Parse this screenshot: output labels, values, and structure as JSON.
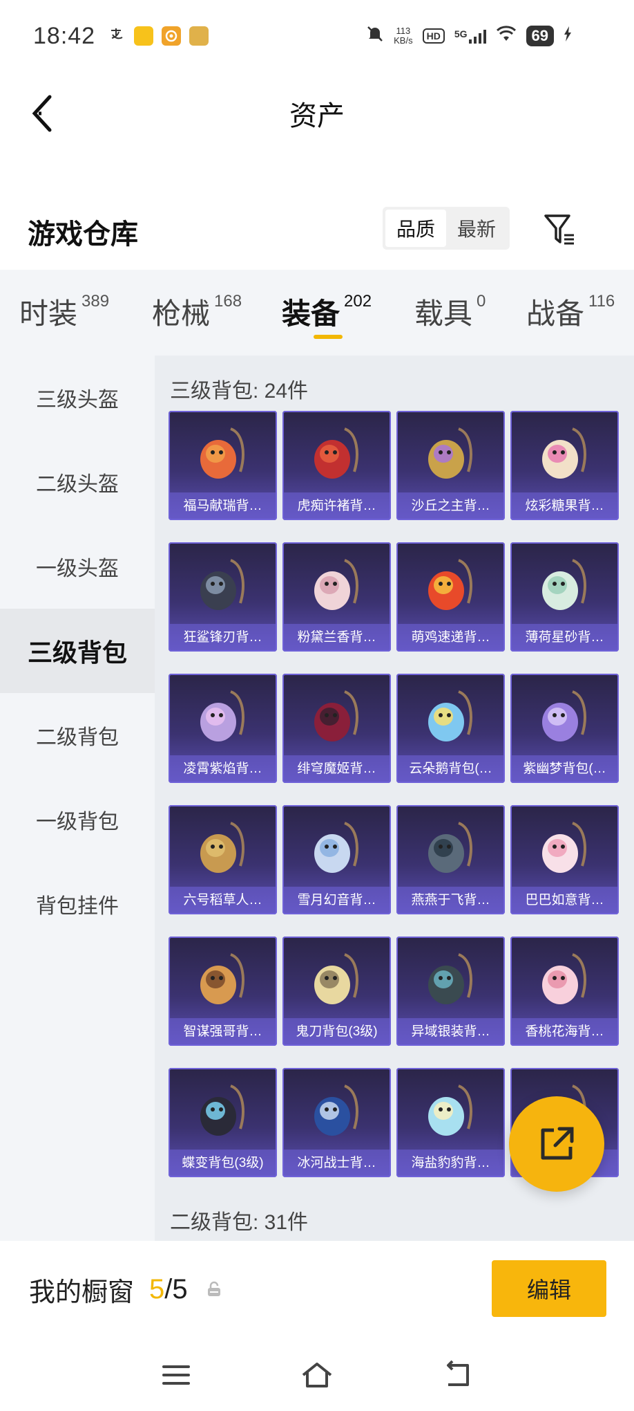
{
  "status_bar": {
    "time": "18:42",
    "net_speed_value": "113",
    "net_speed_unit": "KB/s",
    "hd_label": "HD",
    "network": "5G",
    "battery": "69"
  },
  "header": {
    "title": "资产"
  },
  "section": {
    "title": "游戏仓库",
    "sort_options": [
      "品质",
      "最新"
    ],
    "active_sort": "品质"
  },
  "tabs": [
    {
      "label": "时装",
      "count": "389"
    },
    {
      "label": "枪械",
      "count": "168"
    },
    {
      "label": "装备",
      "count": "202"
    },
    {
      "label": "载具",
      "count": "0"
    },
    {
      "label": "战备",
      "count": "116"
    }
  ],
  "active_tab": "装备",
  "sidebar": {
    "items": [
      "三级头盔",
      "二级头盔",
      "一级头盔",
      "三级背包",
      "二级背包",
      "一级背包",
      "背包挂件"
    ],
    "active": "三级背包"
  },
  "groups": [
    {
      "title": "三级背包: 24件"
    },
    {
      "title": "二级背包: 31件"
    }
  ],
  "items": [
    {
      "name": "福马献瑞背…",
      "icon": "horse-backpack"
    },
    {
      "name": "虎痴许褚背…",
      "icon": "tiger-backpack"
    },
    {
      "name": "沙丘之主背…",
      "icon": "scroll-backpack"
    },
    {
      "name": "炫彩糖果背…",
      "icon": "donut-backpack"
    },
    {
      "name": "狂鲨锋刃背…",
      "icon": "shark-backpack"
    },
    {
      "name": "粉黛兰香背…",
      "icon": "orchid-backpack"
    },
    {
      "name": "萌鸡速递背…",
      "icon": "chick-backpack"
    },
    {
      "name": "薄荷星砂背…",
      "icon": "mint-backpack"
    },
    {
      "name": "凌霄紫焰背…",
      "icon": "flame-backpack"
    },
    {
      "name": "绯穹魔姬背…",
      "icon": "bat-backpack"
    },
    {
      "name": "云朵鹅背包(…",
      "icon": "goose-backpack"
    },
    {
      "name": "紫幽梦背包(…",
      "icon": "dream-backpack"
    },
    {
      "name": "六号稻草人…",
      "icon": "scarecrow-backpack"
    },
    {
      "name": "雪月幻音背…",
      "icon": "snowmoon-backpack"
    },
    {
      "name": "燕燕于飞背…",
      "icon": "swallow-backpack"
    },
    {
      "name": "巴巴如意背…",
      "icon": "pig-backpack"
    },
    {
      "name": "智谋强哥背…",
      "icon": "hamster-backpack"
    },
    {
      "name": "鬼刀背包(3级)",
      "icon": "blade-backpack"
    },
    {
      "name": "异域银装背…",
      "icon": "tactical-backpack"
    },
    {
      "name": "香桃花海背…",
      "icon": "peach-backpack"
    },
    {
      "name": "蝶变背包(3级)",
      "icon": "butterfly-backpack"
    },
    {
      "name": "冰河战士背…",
      "icon": "glacier-backpack"
    },
    {
      "name": "海盐豹豹背…",
      "icon": "seal-backpack"
    },
    {
      "name": "",
      "icon": "hidden-backpack"
    }
  ],
  "showcase": {
    "label": "我的橱窗",
    "current": "5",
    "separator": "/",
    "total": "5",
    "edit_label": "编辑"
  },
  "colors": {
    "accent": "#f2b705",
    "card_purple": "#5b4fb3",
    "sidebar_bg": "#f3f5f8"
  }
}
